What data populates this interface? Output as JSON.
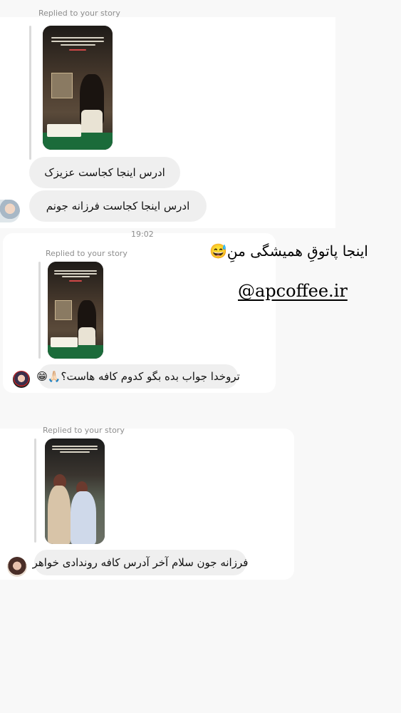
{
  "replied_label": "Replied to your story",
  "card1": {
    "replied": "Replied to your story",
    "messages": [
      "ادرس اینجا کجاست عزیزک",
      "ادرس اینجا کجاست فرزانه جونم"
    ],
    "avatar_icon": "user-avatar-icon"
  },
  "card2": {
    "timestamp": "19:02",
    "replied": "Replied to your story",
    "message": "تروخدا جواب بده بگو کدوم کافه هاست؟🙏🏻😁"
  },
  "card3": {
    "replied": "Replied to your story",
    "message": "فرزانه جون سلام آخر آدرس کافه روندادی خواهر"
  },
  "overlay": {
    "caption": "اینجا پاتوقِ همیشگی منِ😅",
    "handle": "@apcoffee.ir"
  }
}
